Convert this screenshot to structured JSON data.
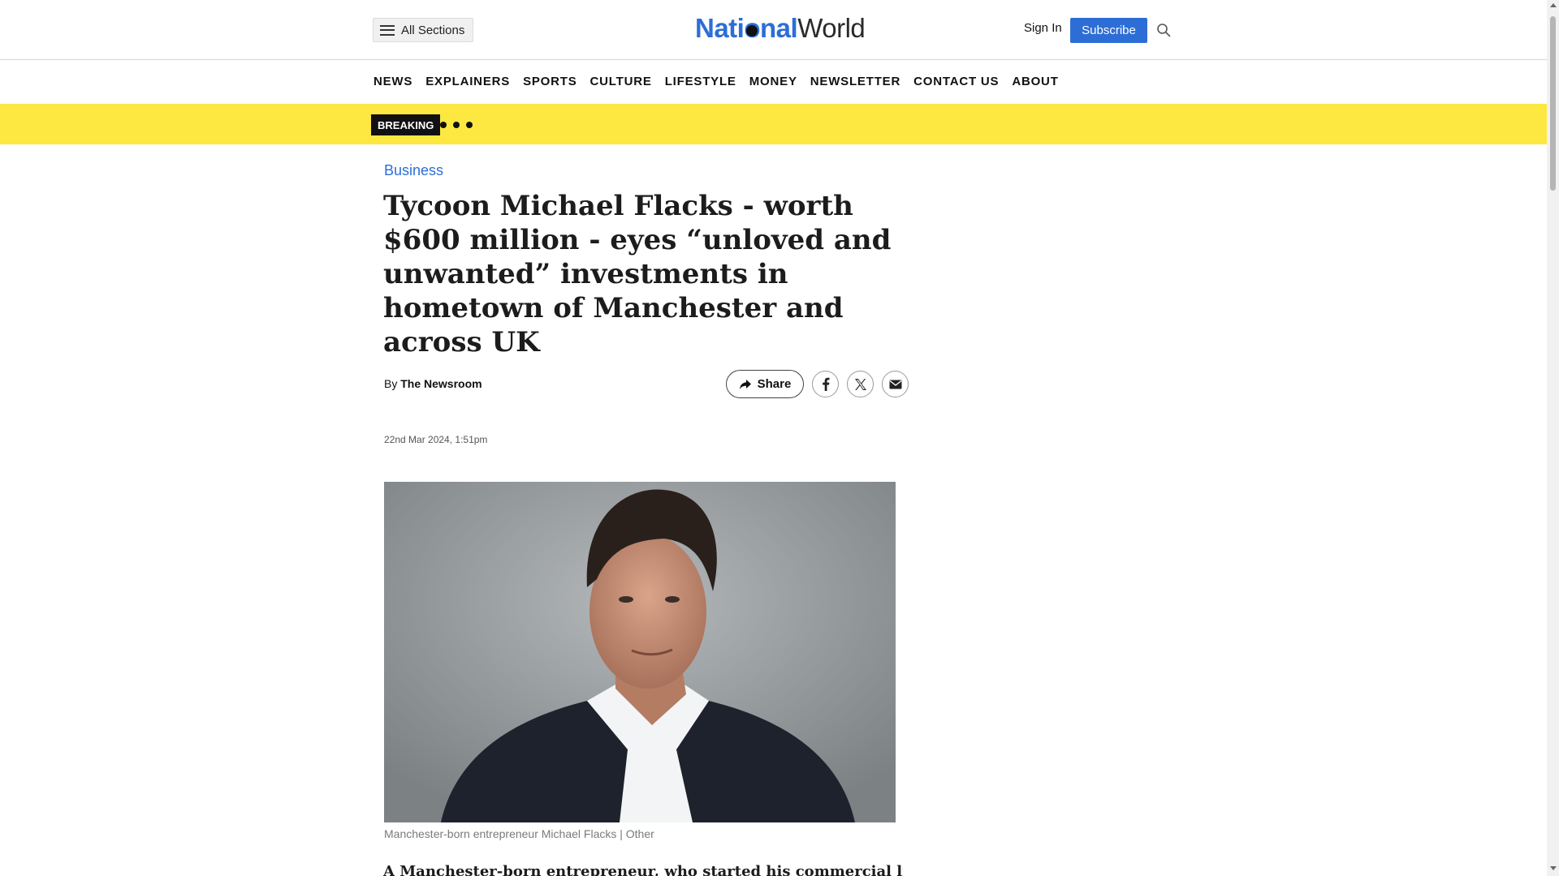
{
  "header": {
    "all_sections_label": "All Sections",
    "logo_national": "Nati",
    "logo_o": "o",
    "logo_nal": "nal",
    "logo_world": "World",
    "sign_in": "Sign In",
    "subscribe": "Subscribe",
    "brand_color": "#2d6ed6"
  },
  "nav": {
    "items": [
      "NEWS",
      "EXPLAINERS",
      "SPORTS",
      "CULTURE",
      "LIFESTYLE",
      "MONEY",
      "NEWSLETTER",
      "CONTACT US",
      "ABOUT"
    ]
  },
  "breaking": {
    "label": "BREAKING",
    "bar_color": "#fde741"
  },
  "article": {
    "category": "Business",
    "headline": "Tycoon Michael Flacks - worth $600 million - eyes “unloved and unwanted” investments in hometown of Manchester and across UK",
    "byline_prefix": "By ",
    "byline_author": "The Newsroom",
    "share_label": "Share",
    "timestamp": "22nd Mar 2024, 1:51pm",
    "image_caption": "Manchester-born entrepreneur Michael Flacks | Other",
    "lead_text": "A Manchester-born entrepreneur, who started his commercial life in"
  },
  "icons": {
    "menu": "hamburger-icon",
    "search": "search-icon",
    "share": "share-arrow-icon",
    "facebook": "facebook-icon",
    "x": "x-icon",
    "email": "email-icon"
  }
}
